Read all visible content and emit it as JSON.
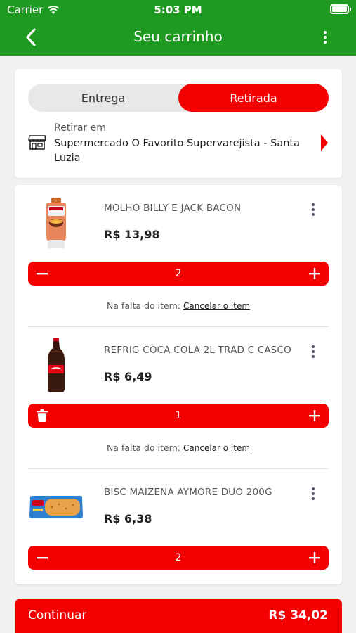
{
  "status_bar": {
    "carrier": "Carrier",
    "time": "5:03 PM",
    "battery_level": 1.0
  },
  "nav": {
    "title": "Seu carrinho"
  },
  "delivery_toggle": {
    "options": [
      "Entrega",
      "Retirada"
    ],
    "selected": "Retirada"
  },
  "pickup": {
    "label": "Retirar em",
    "store": "Supermercado O Favorito Supervarejista - Santa Luzia"
  },
  "cart_items": [
    {
      "name": "MOLHO BILLY E JACK BACON",
      "price": "R$ 13,98",
      "quantity": "2"
    },
    {
      "name": "REFRIG COCA COLA 2L TRAD C CASCO",
      "price": "R$ 6,49",
      "quantity": "1"
    },
    {
      "name": "BISC MAIZENA AYMORE DUO 200G",
      "price": "R$ 6,38",
      "quantity": "2"
    }
  ],
  "missing_item": {
    "text": "Na falta do item:",
    "action": "Cancelar o item"
  },
  "footer": {
    "continue_label": "Continuar",
    "total": "R$ 34,02"
  },
  "colors": {
    "header_green": "#1e9a20",
    "accent_red": "#f40000",
    "background": "#f1f1f1"
  }
}
